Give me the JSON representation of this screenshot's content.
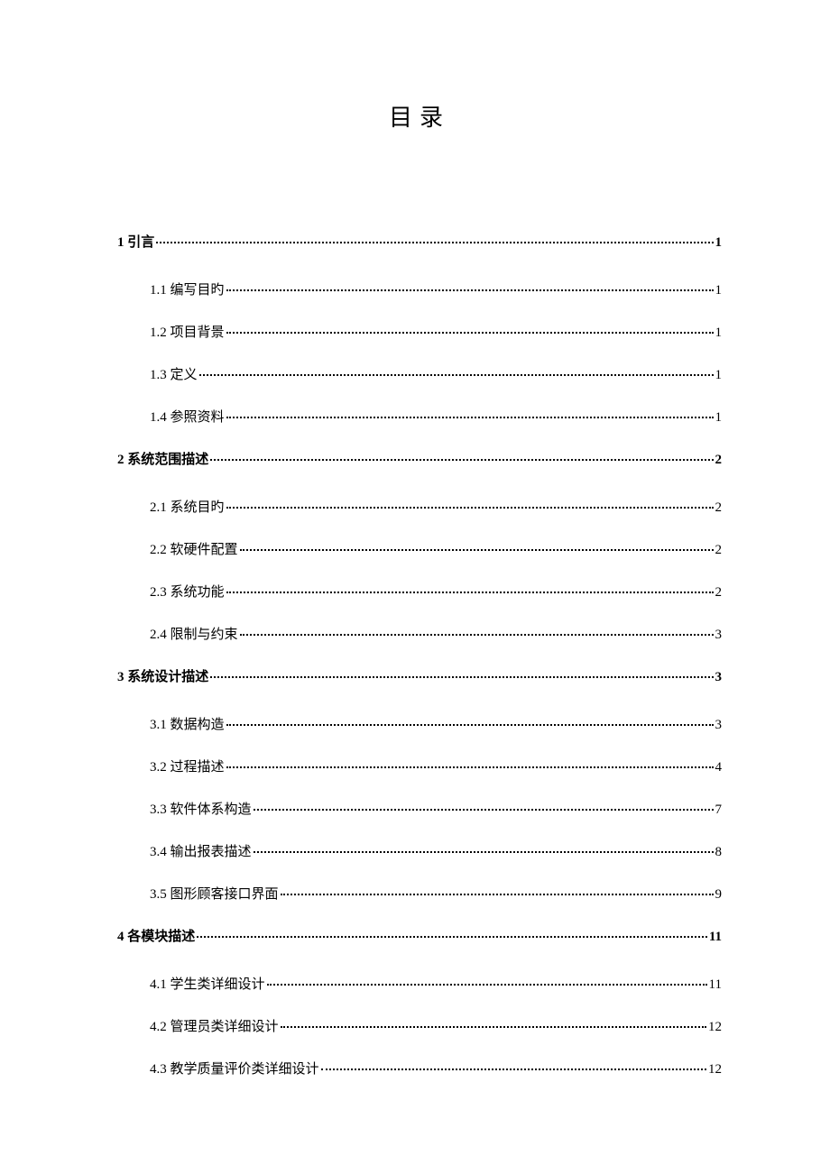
{
  "title": "目录",
  "entries": [
    {
      "level": 1,
      "label": "1 引言",
      "page": "1"
    },
    {
      "level": 2,
      "label": "1.1 编写目旳",
      "page": "1"
    },
    {
      "level": 2,
      "label": "1.2 项目背景",
      "page": "1"
    },
    {
      "level": 2,
      "label": "1.3 定义",
      "page": "1"
    },
    {
      "level": 2,
      "label": "1.4 参照资料",
      "page": "1"
    },
    {
      "level": 1,
      "label": "2 系统范围描述",
      "page": "2"
    },
    {
      "level": 2,
      "label": "2.1 系统目旳",
      "page": "2"
    },
    {
      "level": 2,
      "label": "2.2 软硬件配置",
      "page": "2"
    },
    {
      "level": 2,
      "label": "2.3 系统功能",
      "page": "2"
    },
    {
      "level": 2,
      "label": "2.4 限制与约束",
      "page": "3"
    },
    {
      "level": 1,
      "label": "3 系统设计描述",
      "page": "3"
    },
    {
      "level": 2,
      "label": "3.1 数据构造",
      "page": "3"
    },
    {
      "level": 2,
      "label": "3.2 过程描述",
      "page": "4"
    },
    {
      "level": 2,
      "label": "3.3 软件体系构造",
      "page": "7"
    },
    {
      "level": 2,
      "label": "3.4 输出报表描述",
      "page": "8"
    },
    {
      "level": 2,
      "label": "3.5 图形顾客接口界面",
      "page": "9"
    },
    {
      "level": 1,
      "label": "4 各模块描述",
      "page": "11"
    },
    {
      "level": 2,
      "label": "4.1 学生类详细设计",
      "page": "11"
    },
    {
      "level": 2,
      "label": "4.2 管理员类详细设计",
      "page": "12"
    },
    {
      "level": 2,
      "label": "4.3 教学质量评价类详细设计",
      "page": "12"
    }
  ]
}
